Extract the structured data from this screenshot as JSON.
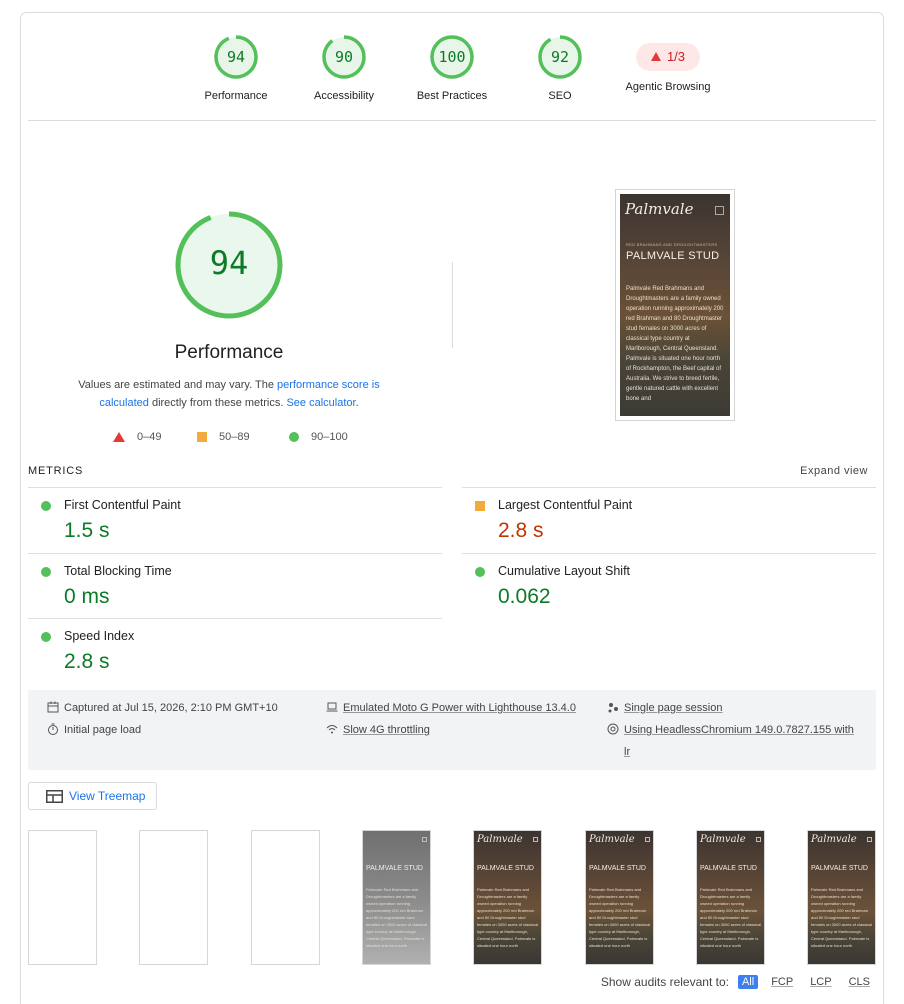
{
  "top_scores": [
    {
      "name": "Performance",
      "score": "94"
    },
    {
      "name": "Accessibility",
      "score": "90"
    },
    {
      "name": "Best Practices",
      "score": "100"
    },
    {
      "name": "SEO",
      "score": "92"
    }
  ],
  "agentic": {
    "label": "Agentic Browsing",
    "value": "1/3"
  },
  "summary": {
    "score": "94",
    "title": "Performance",
    "desc_pre": "Values are estimated and may vary. The ",
    "desc_link1": "performance score is calculated",
    "desc_mid": " directly from these metrics. ",
    "desc_link2": "See calculator",
    "desc_post": ".",
    "legend": {
      "fail": "0–49",
      "average": "50–89",
      "pass": "90–100"
    }
  },
  "screenshot": {
    "logo": "Palmvale",
    "kicker": "RED BRAHMANS AND DROUGHTMASTERS",
    "heading": "PALMVALE STUD",
    "body": "Palmvale Red Brahmans and Droughtmasters are a family owned operation running approximately 200 red Brahman and 80 Droughtmaster stud females on 3000 acres of classical type country at Marlborough, Central Queensland. Palmvale is situated one hour north of Rockhampton, the Beef capital of Australia. We strive to breed fertile, gentle natured cattle with excellent bone and"
  },
  "metrics": {
    "label": "METRICS",
    "expand": "Expand view",
    "items": [
      {
        "name": "First Contentful Paint",
        "value": "1.5 s",
        "rating": "pass"
      },
      {
        "name": "Largest Contentful Paint",
        "value": "2.8 s",
        "rating": "average"
      },
      {
        "name": "Total Blocking Time",
        "value": "0 ms",
        "rating": "pass"
      },
      {
        "name": "Cumulative Layout Shift",
        "value": "0.062",
        "rating": "pass"
      },
      {
        "name": "Speed Index",
        "value": "2.8 s",
        "rating": "pass"
      }
    ]
  },
  "env": {
    "captured": "Captured at Jul 15, 2026, 2:10 PM GMT+10",
    "load": "Initial page load",
    "device": "Emulated Moto G Power with Lighthouse 13.4.0",
    "throttling": "Slow 4G throttling",
    "session": "Single page session",
    "browser_line1": "Using HeadlessChromium 149.0.7827.155 with",
    "browser_line2": "lr"
  },
  "treemap": {
    "label": "View Treemap"
  },
  "filmstrip": {
    "logo": "Palmvale",
    "heading": "PALMVALE STUD",
    "body": "Palmvale Red Brahmans and Droughtmasters are a family owned operation running approximately 200 red Brahman and 80 Droughtmaster stud females on 3000 acres of classical type country at Marlborough, Central Queensland. Palmvale is situated one hour north"
  },
  "filters": {
    "label": "Show audits relevant to:",
    "options": [
      "All",
      "FCP",
      "LCP",
      "CLS"
    ]
  },
  "colors": {
    "pass": "#0c7a26",
    "pass_fill": "#53c05a",
    "average": "#c33300",
    "average_fill": "#f2ab3a",
    "fail": "#e53935",
    "link": "#1a73e8"
  }
}
